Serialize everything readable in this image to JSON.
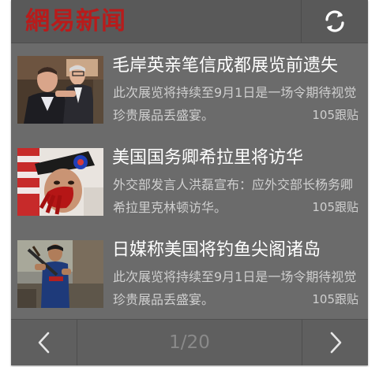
{
  "header": {
    "logo_text": "網易新闻",
    "refresh_icon": "refresh-icon"
  },
  "news": [
    {
      "title": "毛岸英亲笔信成都展览前遗失",
      "summary": "此次展览将持续至9月1日是一场令期待视觉珍贵展品丢盛宴。",
      "comments": "105跟贴",
      "image": "photo of men in suits"
    },
    {
      "title": "美国国务卿希拉里将访华",
      "summary": "外交部发言人洪磊宣布：应外交部长杨务卿希拉里克林顿访华。",
      "comments": "105跟贴",
      "image": "photo of protester with painted hand over mouth"
    },
    {
      "title": "日媒称美国将钓鱼尖阁诸岛",
      "summary": "此次展览将持续至9月1日是一场令期待视觉珍贵展品丢盛宴。",
      "comments": "105跟贴",
      "image": "photo of man in blue uniform holding rifle"
    }
  ],
  "footer": {
    "prev_icon": "chevron-left-icon",
    "page_indicator": "1/20",
    "next_icon": "chevron-right-icon"
  }
}
